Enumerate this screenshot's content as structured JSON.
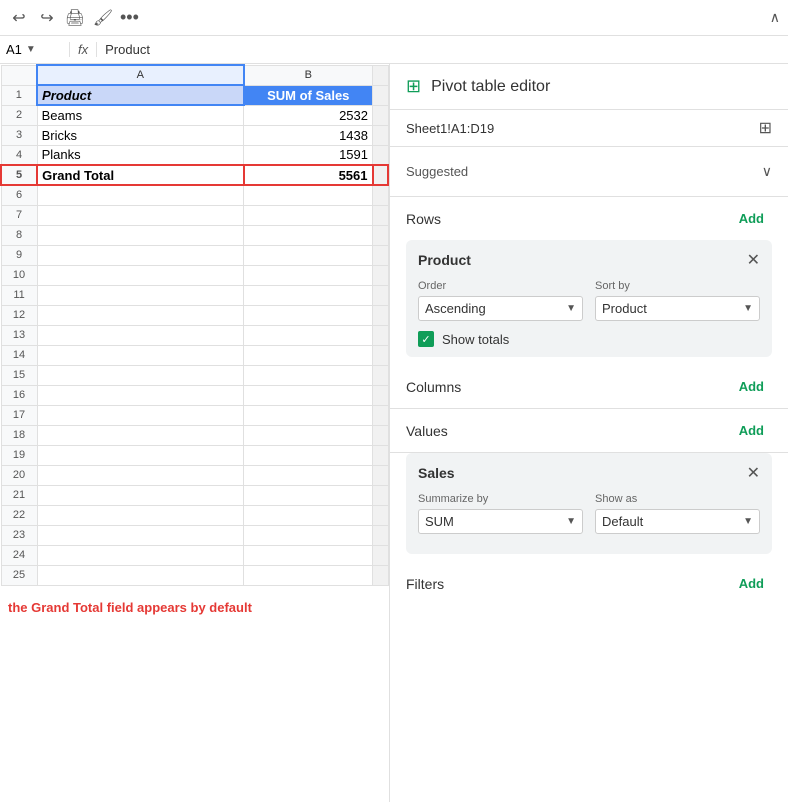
{
  "toolbar": {
    "undo_icon": "↩",
    "redo_icon": "↪",
    "print_icon": "🖨",
    "format_icon": "🖌",
    "more_icon": "•••",
    "collapse_icon": "∧"
  },
  "formula_bar": {
    "cell_ref": "A1",
    "fx_label": "fx",
    "formula_text": "Product"
  },
  "spreadsheet": {
    "col_headers": [
      "",
      "A",
      "B"
    ],
    "rows": [
      {
        "num": "1",
        "a": "Product",
        "b": "SUM of Sales",
        "a_style": "header",
        "b_style": "header"
      },
      {
        "num": "2",
        "a": "Beams",
        "b": "2532",
        "a_style": "",
        "b_style": "right"
      },
      {
        "num": "3",
        "a": "Bricks",
        "b": "1438",
        "a_style": "",
        "b_style": "right"
      },
      {
        "num": "4",
        "a": "Planks",
        "b": "1591",
        "a_style": "",
        "b_style": "right"
      },
      {
        "num": "5",
        "a": "Grand Total",
        "b": "5561",
        "a_style": "bold",
        "b_style": "bold-right",
        "grand_total": true
      },
      {
        "num": "6",
        "a": "",
        "b": ""
      },
      {
        "num": "7",
        "a": "",
        "b": ""
      },
      {
        "num": "8",
        "a": "",
        "b": ""
      },
      {
        "num": "9",
        "a": "",
        "b": ""
      },
      {
        "num": "10",
        "a": "",
        "b": ""
      },
      {
        "num": "11",
        "a": "",
        "b": ""
      },
      {
        "num": "12",
        "a": "",
        "b": ""
      },
      {
        "num": "13",
        "a": "",
        "b": ""
      },
      {
        "num": "14",
        "a": "",
        "b": ""
      },
      {
        "num": "15",
        "a": "",
        "b": ""
      },
      {
        "num": "16",
        "a": "",
        "b": ""
      },
      {
        "num": "17",
        "a": "",
        "b": ""
      },
      {
        "num": "18",
        "a": "",
        "b": ""
      },
      {
        "num": "19",
        "a": "",
        "b": ""
      },
      {
        "num": "20",
        "a": "",
        "b": ""
      },
      {
        "num": "21",
        "a": "",
        "b": ""
      },
      {
        "num": "22",
        "a": "",
        "b": ""
      },
      {
        "num": "23",
        "a": "",
        "b": ""
      },
      {
        "num": "24",
        "a": "",
        "b": ""
      },
      {
        "num": "25",
        "a": "",
        "b": ""
      }
    ],
    "annotation": "the Grand Total field appears by default"
  },
  "pivot_panel": {
    "title": "Pivot table editor",
    "data_range": "Sheet1!A1:D19",
    "suggested_label": "Suggested",
    "rows_label": "Rows",
    "rows_add": "Add",
    "rows_card": {
      "title": "Product",
      "order_label": "Order",
      "order_value": "Ascending",
      "sort_by_label": "Sort by",
      "sort_by_value": "Product",
      "show_totals_label": "Show totals",
      "show_totals_checked": true
    },
    "columns_label": "Columns",
    "columns_add": "Add",
    "values_label": "Values",
    "values_add": "Add",
    "values_card": {
      "title": "Sales",
      "summarize_label": "Summarize by",
      "summarize_value": "SUM",
      "show_as_label": "Show as",
      "show_as_value": "Default"
    },
    "filters_label": "Filters",
    "filters_add": "Add"
  }
}
